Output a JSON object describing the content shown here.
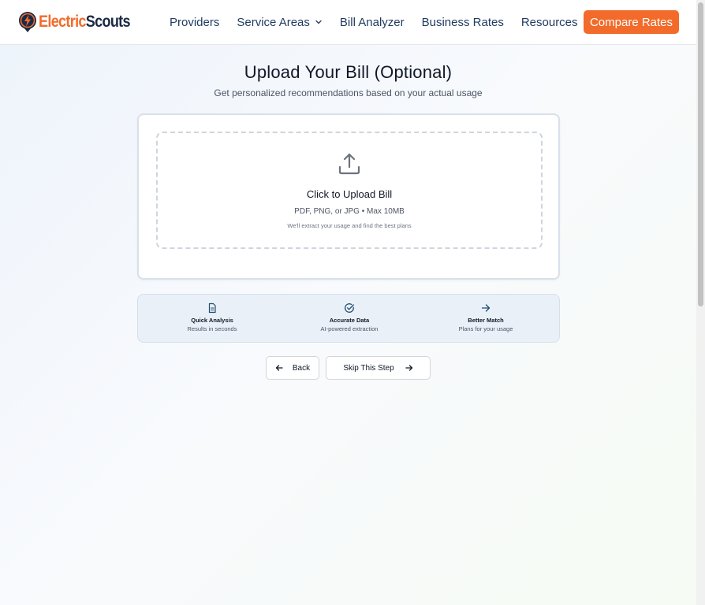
{
  "header": {
    "logo": {
      "text_a": "Electric",
      "text_b": "Scouts",
      "icon": "lightning-bolt-icon"
    },
    "nav": [
      {
        "label": "Providers",
        "has_dropdown": false
      },
      {
        "label": "Service Areas",
        "has_dropdown": true
      },
      {
        "label": "Bill Analyzer",
        "has_dropdown": false
      },
      {
        "label": "Business Rates",
        "has_dropdown": false
      },
      {
        "label": "Resources",
        "has_dropdown": true
      }
    ],
    "cta_label": "Compare Rates"
  },
  "main": {
    "title": "Upload Your Bill (Optional)",
    "subtitle": "Get personalized recommendations based on your actual usage",
    "upload": {
      "icon": "upload-icon",
      "title": "Click to Upload Bill",
      "formats": "PDF, PNG, or JPG • Max 10MB",
      "note": "We'll extract your usage and find the best plans"
    },
    "features": [
      {
        "icon": "document-icon",
        "title": "Quick Analysis",
        "desc": "Results in seconds"
      },
      {
        "icon": "check-circle-icon",
        "title": "Accurate Data",
        "desc": "AI-powered extraction"
      },
      {
        "icon": "arrow-right-icon",
        "title": "Better Match",
        "desc": "Plans for your usage"
      }
    ],
    "back_label": "Back",
    "skip_label": "Skip This Step"
  },
  "colors": {
    "accent": "#f26b2a",
    "brand_dark": "#1b2a44",
    "nav_text": "#1f3a5f",
    "feature_icon": "#1e4d6b"
  }
}
